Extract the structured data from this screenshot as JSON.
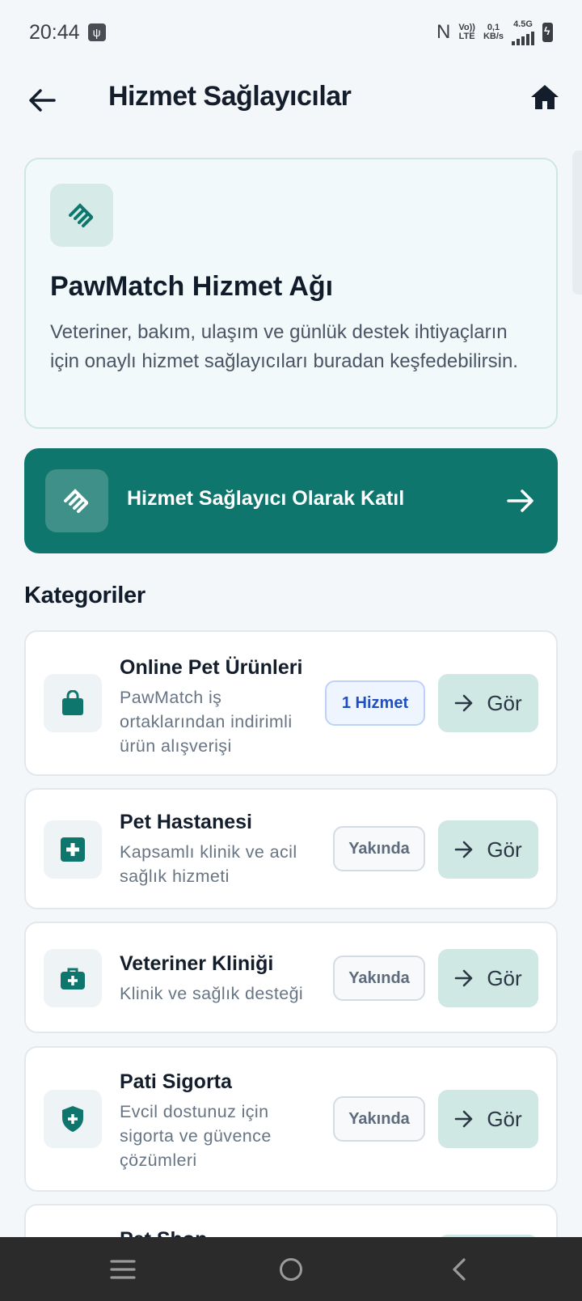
{
  "status_bar": {
    "time": "20:44",
    "volte_top": "Vo))",
    "volte_bottom": "LTE",
    "speed_value": "0,1",
    "speed_unit": "KB/s",
    "network": "4.5G"
  },
  "header": {
    "title": "Hizmet Sağlayıcılar"
  },
  "hero": {
    "title": "PawMatch Hizmet Ağı",
    "description": "Veteriner, bakım, ulaşım ve günlük destek ihtiyaçların için onaylı hizmet sağlayıcıları buradan keşfedebilirsin."
  },
  "cta": {
    "label": "Hizmet Sağlayıcı Olarak Katıl"
  },
  "categories": {
    "title": "Kategoriler",
    "items": [
      {
        "title": "Online Pet Ürünleri",
        "description": "PawMatch iş ortaklarından indirimli ürün alışverişi",
        "badge": "1 Hizmet",
        "button": "Gör",
        "icon": "shopping-bag-icon"
      },
      {
        "title": "Pet Hastanesi",
        "description": "Kapsamlı klinik ve acil sağlık hizmeti",
        "badge": "Yakında",
        "button": "Gör",
        "icon": "medical-cross-icon"
      },
      {
        "title": "Veteriner Kliniği",
        "description": "Klinik ve sağlık desteği",
        "badge": "Yakında",
        "button": "Gör",
        "icon": "medical-bag-icon"
      },
      {
        "title": "Pati Sigorta",
        "description": "Evcil dostunuz için sigorta ve güvence çözümleri",
        "badge": "Yakında",
        "button": "Gör",
        "icon": "shield-plus-icon"
      },
      {
        "title": "Pet Shop"
      }
    ]
  },
  "colors": {
    "primary": "#0f766e",
    "text_dark": "#111c2b",
    "text_muted": "#687584",
    "badge_blue": "#1e4fc4"
  }
}
